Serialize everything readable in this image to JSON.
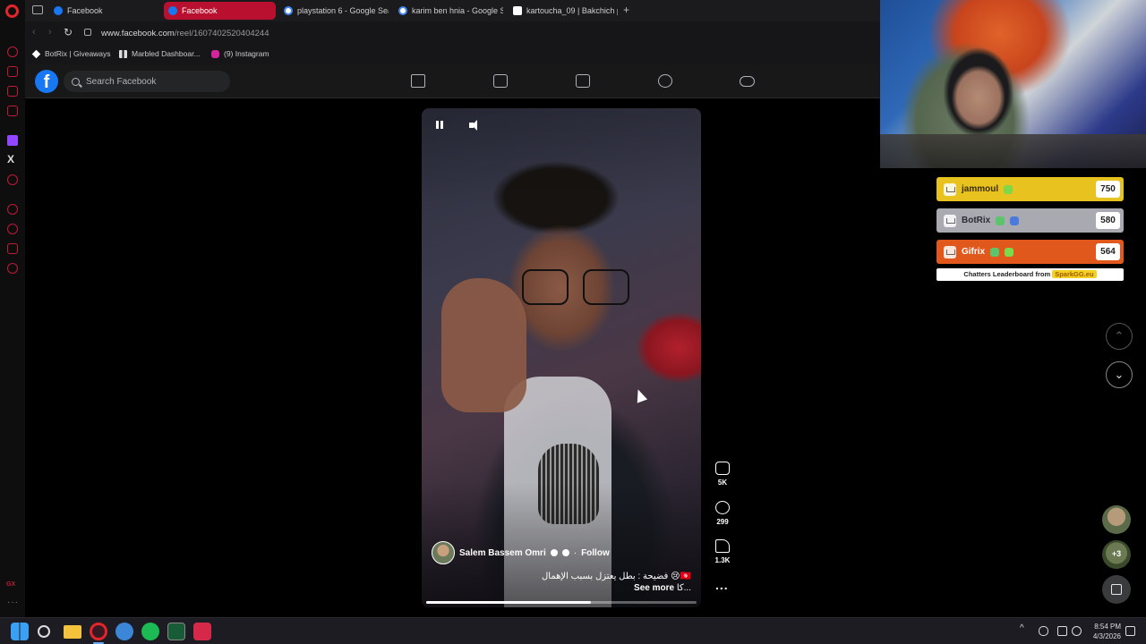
{
  "browser": {
    "tabs": [
      {
        "label": "Facebook",
        "favicon": "facebook-icon",
        "active": false
      },
      {
        "label": "Facebook",
        "favicon": "facebook-icon",
        "active": true
      },
      {
        "label": "playstation 6 - Google Sea",
        "favicon": "google-icon",
        "active": false
      },
      {
        "label": "karim ben hnia - Google S",
        "favicon": "google-icon",
        "active": false
      },
      {
        "label": "kartoucha_09 | Bakchich p",
        "favicon": "kick-icon",
        "active": false
      }
    ],
    "new_tab_label": "+",
    "url_prefix": "www.facebook.com",
    "url_path": "/reel/1607402520404244",
    "bookmarks": [
      {
        "label": "BotRix | Giveaways",
        "icon": "botrix-icon"
      },
      {
        "label": "Marbled Dashboar...",
        "icon": "grid-icon"
      },
      {
        "label": "(9) Instagram",
        "icon": "instagram-icon"
      }
    ]
  },
  "facebook": {
    "logo_letter": "f",
    "search_placeholder": "Search Facebook",
    "nav_icons": [
      "home-icon",
      "video-icon",
      "marketplace-icon",
      "groups-icon",
      "gaming-icon"
    ]
  },
  "reel": {
    "author_name": "Salem Bassem Omri",
    "follow_separator": "·",
    "follow_label": "Follow",
    "caption_line": "فضيحة : بطل يعتزل بسبب الإهمال 😢🇹🇳",
    "caption_line2_prefix": "كا...",
    "see_more_label": "See more",
    "progress_fraction": 0.61,
    "likes": "5K",
    "comments": "299",
    "shares": "1.3K",
    "more_label": "..."
  },
  "leaderboard": {
    "rows": [
      {
        "name": "jammoul",
        "score": "750",
        "color": "#e8c21e",
        "badge_colors": [
          "#7bd94a"
        ]
      },
      {
        "name": "BotRix",
        "score": "580",
        "color": "#a9a9b2",
        "badge_colors": [
          "#5cc46a",
          "#4a7bdc"
        ]
      },
      {
        "name": "Gifrix",
        "score": "564",
        "color": "#e0581c",
        "badge_colors": [
          "#5cc46a",
          "#7bd94a"
        ]
      }
    ],
    "footer_text": "Chatters Leaderboard from",
    "footer_brand": "SparkGG.eu"
  },
  "side_nav": {
    "up_label": "⌃",
    "down_label": "⌄",
    "contact_extra": "+3"
  },
  "taskbar": {
    "time": "8:54 PM",
    "date": "4/3/2026",
    "tray_caret": "^"
  },
  "sidebar": {
    "x_label": "X",
    "gx_label": "GX",
    "dots_label": "···"
  }
}
